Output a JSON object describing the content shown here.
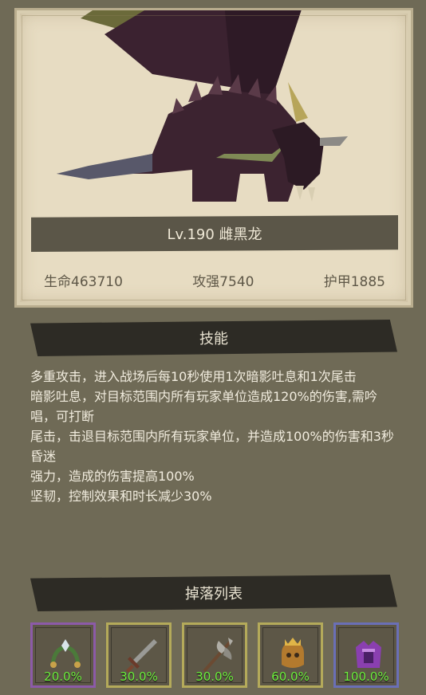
{
  "monster": {
    "name": "Lv.190 雌黑龙",
    "stats": {
      "hp": "生命463710",
      "atk": "攻强7540",
      "armor": "护甲1885"
    }
  },
  "skills": {
    "title": "技能",
    "lines": [
      "多重攻击，进入战场后每10秒使用1次暗影吐息和1次尾击",
      "暗影吐息，对目标范围内所有玩家单位造成120%的伤害,需吟唱，可打断",
      "尾击，击退目标范围内所有玩家单位，并造成100%的伤害和3秒昏迷",
      "强力，造成的伤害提高100%",
      "坚韧，控制效果和时长减少30%"
    ]
  },
  "drops": {
    "title": "掉落列表",
    "items": [
      {
        "icon": "necklace-icon",
        "rate": "20.0%",
        "border": "#8c5aa8"
      },
      {
        "icon": "sword-icon",
        "rate": "30.0%",
        "border": "#b4aa5a"
      },
      {
        "icon": "axe-icon",
        "rate": "30.0%",
        "border": "#b4aa5a"
      },
      {
        "icon": "helmet-icon",
        "rate": "60.0%",
        "border": "#b4aa5a"
      },
      {
        "icon": "armor-icon",
        "rate": "100.0%",
        "border": "#6a6fb6"
      }
    ]
  }
}
